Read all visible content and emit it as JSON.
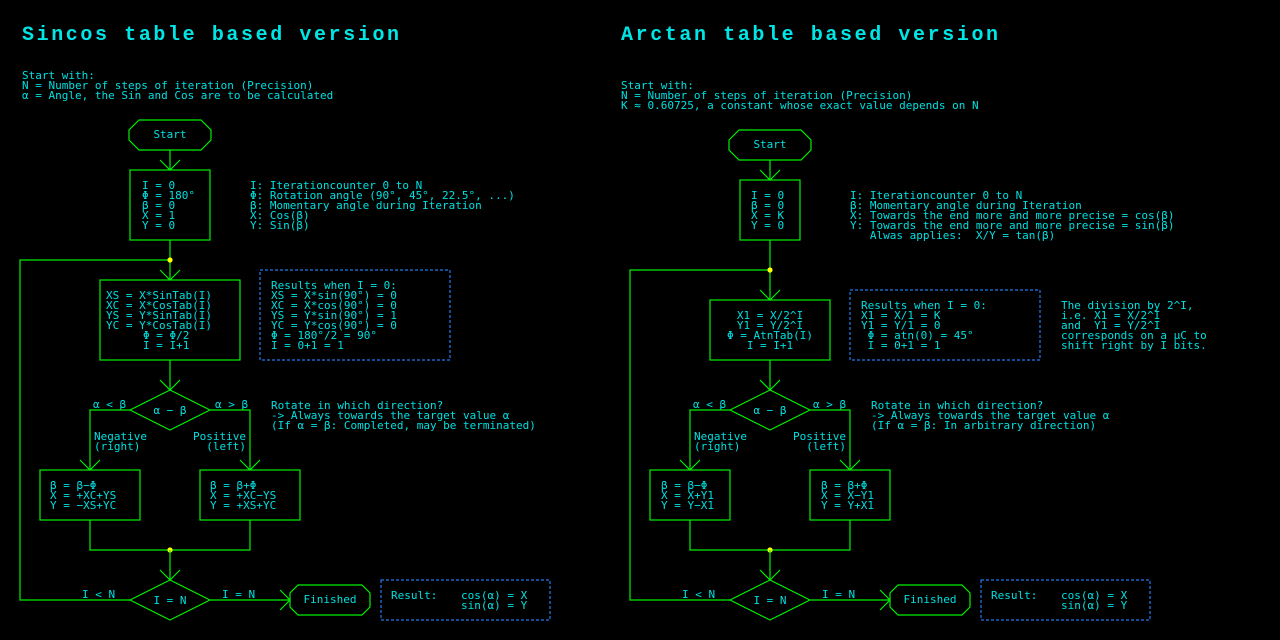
{
  "left": {
    "title": "Sincos table based version",
    "intro": [
      "Start with:",
      "N = Number of steps of iteration (Precision)",
      "α = Angle, the Sin and Cos are to be calculated"
    ],
    "start_label": "Start",
    "init_box": [
      "I = 0",
      "Φ = 180°",
      "β = 0",
      "X = 1",
      "Y = 0"
    ],
    "init_notes": [
      "I: Iterationcounter 0 to N",
      "Φ: Rotation angle (90°, 45°, 22.5°, ...)",
      "β: Momentary angle during Iteration",
      "X: Cos(β)",
      "Y: Sin(β)"
    ],
    "calc_box": [
      "XS = X*SinTab(I)",
      "XC = X*CosTab(I)",
      "YS = Y*SinTab(I)",
      "YC = Y*CosTab(I)",
      "Φ = Φ/2",
      "I = I+1"
    ],
    "results_box": [
      "Results when I = 0:",
      "XS = X*sin(90°) = 0",
      "XC = X*cos(90°) = 0",
      "YS = Y*sin(90°) = 1",
      "YC = Y*cos(90°) = 0",
      "Φ = 180°/2 = 90°",
      "I = 0+1 = 1"
    ],
    "decision_label": "α − β",
    "branch_left_cond": "α < β",
    "branch_right_cond": "α > β",
    "branch_left_label": [
      "Negative",
      "(right)"
    ],
    "branch_right_label": [
      "Positive",
      "(left)"
    ],
    "direction_notes": [
      "Rotate in which direction?",
      "-> Always towards the target value α",
      "(If α = β: Completed, may be terminated)"
    ],
    "neg_box": [
      "β = β−Φ",
      "X = +XC+YS",
      "Y = −XS+YC"
    ],
    "pos_box": [
      "β = β+Φ",
      "X = +XC−YS",
      "Y = +XS+YC"
    ],
    "loop_decision": "I = N",
    "loop_cond": "I < N",
    "exit_cond": "I = N",
    "finished_label": "Finished",
    "result_label": "Result:",
    "result_lines": [
      "cos(α) = X",
      "sin(α) = Y"
    ]
  },
  "right": {
    "title": "Arctan table based version",
    "intro": [
      "Start with:",
      "N = Number of steps of iteration (Precision)",
      "K ≈ 0.60725, a constant whose exact value depends on N"
    ],
    "start_label": "Start",
    "init_box": [
      "I = 0",
      "β = 0",
      "X = K",
      "Y = 0"
    ],
    "init_notes": [
      "I: Iterationcounter 0 to N",
      "β: Momentary angle during Iteration",
      "X: Towards the end more and more precise = cos(β)",
      "Y: Towards the end more and more precise = sin(β)",
      "   Alwas applies:  X/Y = tan(β)"
    ],
    "calc_box": [
      "X1 = X/2^I",
      "Y1 = Y/2^I",
      "Φ = AtnTab(I)",
      "I = I+1"
    ],
    "results_box": [
      "Results when I = 0:",
      "X1 = X/1 = K",
      "Y1 = Y/1 = 0",
      " Φ = atn(0) = 45°",
      " I = 0+1 = 1"
    ],
    "shift_notes": [
      "The division by 2^I,",
      "i.e. X1 = X/2^I",
      "and  Y1 = Y/2^I",
      "corresponds on a µC to",
      "shift right by I bits."
    ],
    "decision_label": "α − β",
    "branch_left_cond": "α < β",
    "branch_right_cond": "α > β",
    "branch_left_label": [
      "Negative",
      "(right)"
    ],
    "branch_right_label": [
      "Positive",
      "(left)"
    ],
    "direction_notes": [
      "Rotate in which direction?",
      "-> Always towards the target value α",
      "(If α = β: In arbitrary direction)"
    ],
    "neg_box": [
      "β = β−Φ",
      "X = X+Y1",
      "Y = Y−X1"
    ],
    "pos_box": [
      "β = β+Φ",
      "X = X−Y1",
      "Y = Y+X1"
    ],
    "loop_decision": "I = N",
    "loop_cond": "I < N",
    "exit_cond": "I = N",
    "finished_label": "Finished",
    "result_label": "Result:",
    "result_lines": [
      "cos(α) = X",
      "sin(α) = Y"
    ]
  }
}
